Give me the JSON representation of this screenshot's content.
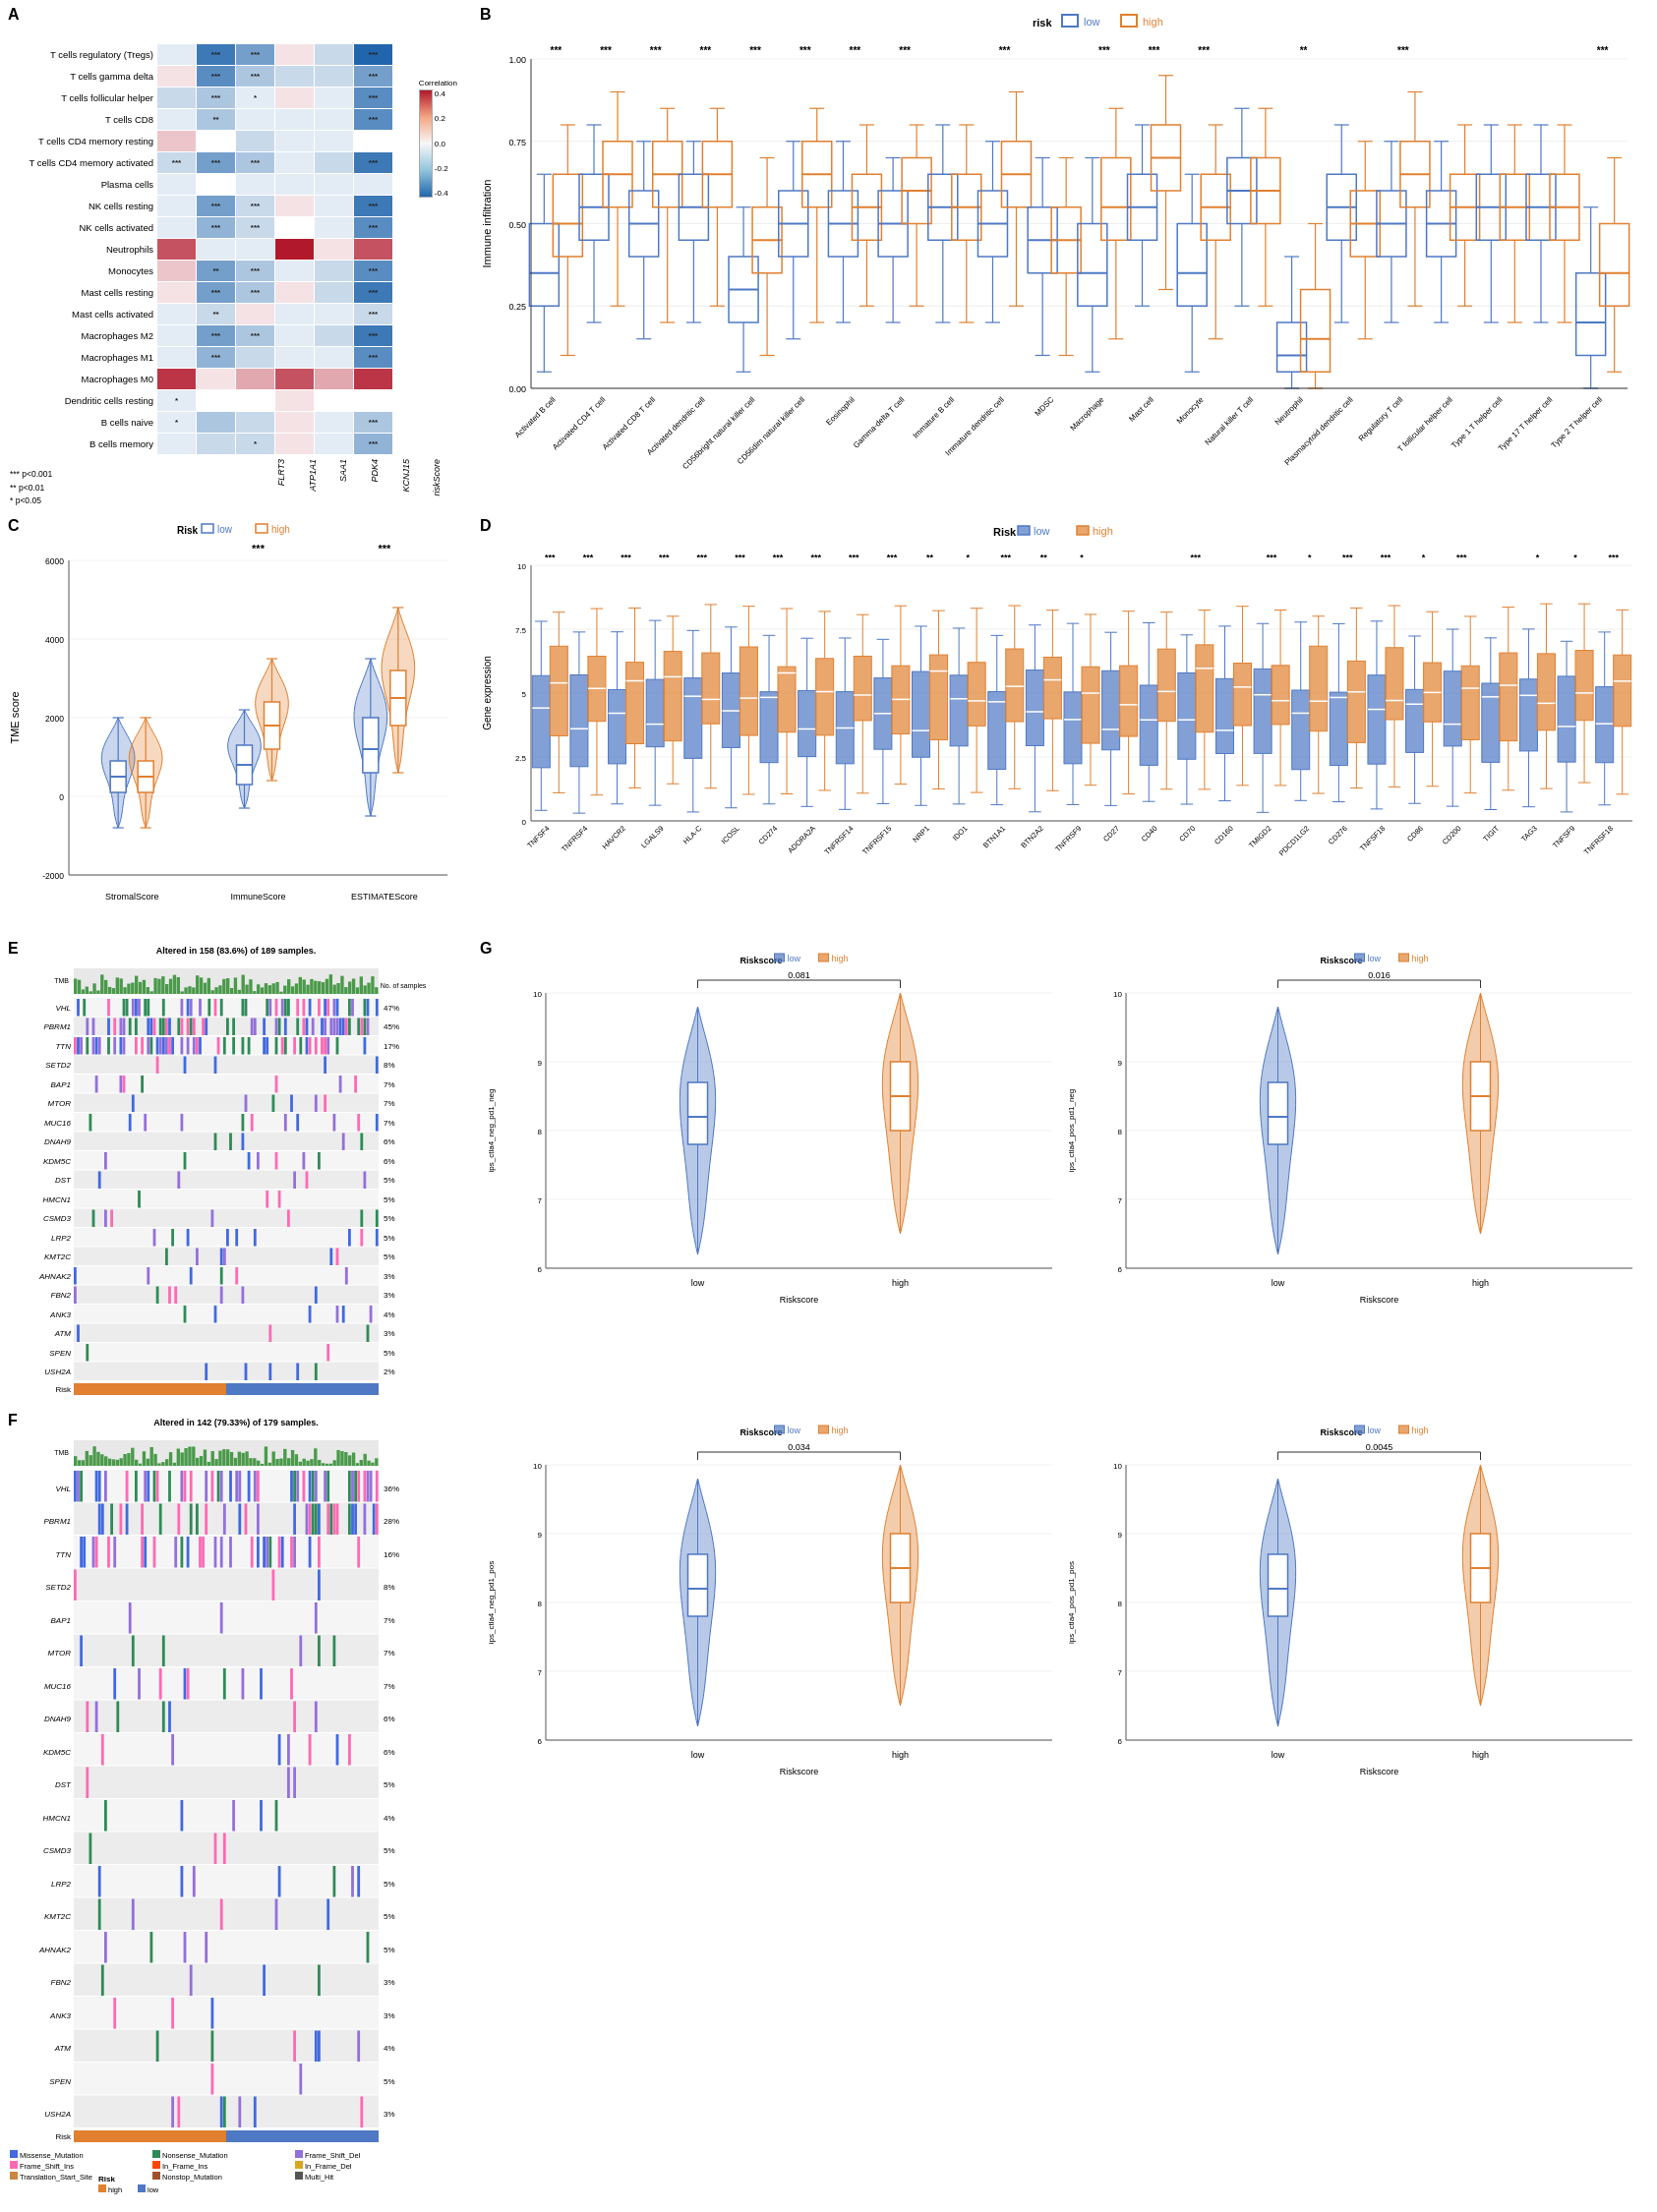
{
  "panels": {
    "A": {
      "label": "A",
      "title": "Heatmap",
      "rows": [
        "T cells regulatory (Tregs)",
        "T cells gamma delta",
        "T cells follicular helper",
        "T cells CD8",
        "T cells CD4 memory resting",
        "T cells CD4 memory activated",
        "Plasma cells",
        "NK cells resting",
        "NK cells activated",
        "Neutrophils",
        "Monocytes",
        "Mast cells resting",
        "Mast cells activated",
        "Macrophages M2",
        "Macrophages M1",
        "Macrophages M0",
        "Dendritic cells resting",
        "B cells naive",
        "B cells memory"
      ],
      "cols": [
        "FLRT3",
        "ATP1A1",
        "SAA1",
        "PDK4",
        "KCNJ15",
        "riskScore"
      ],
      "significance_legend": [
        "*** p<0.001",
        "** p<0.01",
        "* p<0.05"
      ],
      "color_legend_title": "Correlation",
      "color_legend_values": [
        "0.4",
        "0.2",
        "0.0",
        "-0.2",
        "-0.4"
      ]
    },
    "B": {
      "label": "B",
      "title": "Immune infiltration boxplot",
      "y_label": "Immune infiltration",
      "legend_title": "risk",
      "legend_items": [
        {
          "label": "low",
          "color": "#4e78c4"
        },
        {
          "label": "high",
          "color": "#e08030"
        }
      ],
      "x_labels": [
        "Activated B cell",
        "Activated CD4 T cell",
        "Activated CD8 T cell",
        "Activated dendritic cell",
        "CD56bright natural killer cell",
        "CD56dim natural killer cell",
        "Eosinophil",
        "Gamma-delta T cell",
        "Immature B cell",
        "Immature dendritic cell",
        "MDSC",
        "Macrophage",
        "Mast cell",
        "Monocyte",
        "Natural killer T cell",
        "Neutrophil",
        "Plasmacytoid dendritic cell",
        "Regulatory T cell",
        "T follicular helper cell",
        "Type 1 T helper cell",
        "Type 17 T helper cell",
        "Type 2 T helper cell"
      ],
      "sig_labels": [
        "***",
        "***",
        "***",
        "***",
        "***",
        "***",
        "***",
        "***",
        "",
        "***",
        "",
        "***",
        "***",
        "***",
        "",
        "**",
        "",
        "***",
        "",
        "",
        "",
        "***"
      ]
    },
    "C": {
      "label": "C",
      "title": "TME score violin",
      "y_label": "TME score",
      "y_max": 6000,
      "y_min": -2000,
      "legend_items": [
        {
          "label": "low",
          "color": "#4e78c4"
        },
        {
          "label": "high",
          "color": "#e08030"
        }
      ],
      "groups": [
        "StromalScore",
        "ImmuneScore",
        "ESTIMATEScore"
      ],
      "sig": [
        "",
        "***",
        "***"
      ]
    },
    "D": {
      "label": "D",
      "title": "Gene expression boxplot",
      "y_label": "Gene expression",
      "legend_items": [
        {
          "label": "low",
          "color": "#4e78c4"
        },
        {
          "label": "high",
          "color": "#e08030"
        }
      ],
      "genes": [
        "TNFSF4",
        "TNFRSF4",
        "HAVCR2",
        "LGALS9",
        "HLA-C",
        "ICOSL",
        "CD274",
        "ADORA2A",
        "TNFRSF14",
        "TNFRSF15",
        "NRP1",
        "IDO1",
        "BTN1A1",
        "BTN2A2",
        "TNFRSF9",
        "CD27",
        "CD40",
        "CD70",
        "CD160",
        "TMIGD2",
        "PDCD1LG2",
        "CD276",
        "TNFSF18",
        "CD86",
        "CD200",
        "TIGIT",
        "TAG3",
        "TNFSF9",
        "TNFRSF18"
      ],
      "sig_row": [
        "***",
        "***",
        "***",
        "***",
        "***",
        "***",
        "***",
        "***",
        "***",
        "***",
        "**",
        "*",
        "***",
        "**",
        "*",
        "",
        "",
        "***",
        "",
        "***",
        "*",
        "***",
        "***",
        "*",
        "***",
        "",
        "*",
        "*",
        "***"
      ]
    },
    "E": {
      "label": "E",
      "title": "Altered in 158 (83.6%) of 189 samples.",
      "genes": [
        "VHL",
        "PBRM1",
        "TTN",
        "SETD2",
        "BAP1",
        "MTOR",
        "MUC16",
        "DNAH9",
        "KDM5C",
        "DST",
        "HMCN1",
        "CSMD3",
        "LRP2",
        "KMT2C",
        "AHNAK2",
        "FBN2",
        "ANK3",
        "ATM",
        "SPEN",
        "USH2A"
      ],
      "percentages": [
        "47%",
        "45%",
        "17%",
        "8%",
        "7%",
        "7%",
        "7%",
        "6%",
        "6%",
        "5%",
        "5%",
        "5%",
        "5%",
        "5%",
        "3%",
        "3%",
        "4%",
        "3%",
        "5%",
        "2%"
      ],
      "legend": {
        "mutation_types": [
          {
            "label": "Nonsense_Mutation",
            "color": "#2e8b57"
          },
          {
            "label": "Frame_Shift_Del",
            "color": "#9370db"
          },
          {
            "label": "Missense_Mutation",
            "color": "#4169e1"
          },
          {
            "label": "Frame_Shift_Ins",
            "color": "#ff69b4"
          }
        ],
        "other_types": [
          {
            "label": "In_Frame_Del",
            "color": "#daa520"
          },
          {
            "label": "Nonstop_Mutation",
            "color": "#cd853f"
          },
          {
            "label": "In_Frame_Ins",
            "color": "#ff6347"
          }
        ],
        "risk_types": [
          {
            "label": "high",
            "color": "#e08030"
          },
          {
            "label": "low",
            "color": "#4e78c4"
          }
        ]
      }
    },
    "F": {
      "label": "F",
      "title": "Altered in 142 (79.33%) of 179 samples.",
      "genes": [
        "VHL",
        "PBRM1",
        "TTN",
        "SETD2",
        "BAP1",
        "MTOR",
        "MUC16",
        "DNAH9",
        "KDM5C",
        "DST",
        "HMCN1",
        "CSMD3",
        "LRP2",
        "KMT2C",
        "AHNAK2",
        "FBN2",
        "ANK3",
        "ATM",
        "SPEN",
        "USH2A"
      ],
      "percentages": [
        "36%",
        "28%",
        "16%",
        "8%",
        "7%",
        "7%",
        "7%",
        "6%",
        "6%",
        "5%",
        "4%",
        "5%",
        "5%",
        "5%",
        "5%",
        "3%",
        "3%",
        "4%",
        "5%",
        "3%"
      ],
      "legend": {
        "mutation_types": [
          {
            "label": "Missense_Mutation",
            "color": "#4169e1"
          },
          {
            "label": "Nonsense_Mutation",
            "color": "#2e8b57"
          },
          {
            "label": "Frame_Shift_Del",
            "color": "#9370db"
          },
          {
            "label": "Frame_Shift_Ins",
            "color": "#ff69b4"
          },
          {
            "label": "In_Frame_Ins",
            "color": "#ff6347"
          }
        ],
        "other_types": [
          {
            "label": "In_Frame_Del",
            "color": "#daa520"
          },
          {
            "label": "Translation_Start_Site",
            "color": "#cd853f"
          },
          {
            "label": "Nonstop_Mutation",
            "color": "#a0522d"
          },
          {
            "label": "Multi_Hit",
            "color": "#333"
          }
        ],
        "risk_types": [
          {
            "label": "high",
            "color": "#e08030"
          },
          {
            "label": "low",
            "color": "#4e78c4"
          }
        ]
      }
    },
    "G": {
      "label": "G",
      "plots": [
        {
          "title": "ips_ctla4_neg_pd1_neg",
          "x_labels": [
            "low",
            "high"
          ],
          "p_value": "0.081",
          "y_label": "ips_ctla4_neg_pd1_neg",
          "legend": {
            "low": "#4e78c4",
            "high": "#e08030"
          }
        },
        {
          "title": "ips_ctla4_pos_pd1_neg",
          "x_labels": [
            "low",
            "high"
          ],
          "p_value": "0.016",
          "y_label": "ips_ctla4_pos_pd1_neg",
          "legend": {
            "low": "#4e78c4",
            "high": "#e08030"
          }
        },
        {
          "title": "ips_ctla4_neg_pd1_pos",
          "x_labels": [
            "low",
            "high"
          ],
          "p_value": "0.034",
          "y_label": "ips_ctla4_neg_pd1_pos",
          "legend": {
            "low": "#4e78c4",
            "high": "#e08030"
          }
        },
        {
          "title": "ips_ctla4_pos_pd1_pos",
          "x_labels": [
            "low",
            "high"
          ],
          "p_value": "0.0045",
          "y_label": "ips_ctla4_pos_pd1_pos",
          "legend": {
            "low": "#4e78c4",
            "high": "#e08030"
          }
        }
      ]
    }
  }
}
